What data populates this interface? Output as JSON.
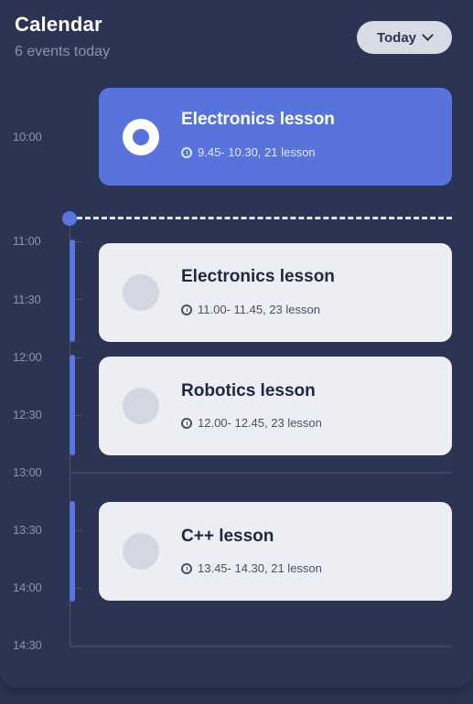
{
  "header": {
    "title": "Calendar",
    "subtitle": "6 events today",
    "today_button": "Today"
  },
  "timeline": {
    "labels": [
      "10:00",
      "11:00",
      "11:30",
      "12:00",
      "12:30",
      "13:00",
      "13:30",
      "14:00",
      "14:30"
    ]
  },
  "events": [
    {
      "name": "Electronics lesson",
      "time": "9.45- 10.30, 21 lesson",
      "active": true
    },
    {
      "name": "Electronics lesson",
      "time": "11.00- 11.45, 23 lesson",
      "active": false
    },
    {
      "name": "Robotics lesson",
      "time": "12.00- 12.45, 23 lesson",
      "active": false
    },
    {
      "name": "C++ lesson",
      "time": "13.45- 14.30, 21 lesson",
      "active": false
    }
  ],
  "colors": {
    "background": "#2b3452",
    "accent": "#5874dc",
    "card": "#eceef3"
  },
  "icons": {
    "today_chevron": "chevron-down-icon",
    "time": "clock-icon",
    "event_avatar": "event-avatar-icon"
  }
}
